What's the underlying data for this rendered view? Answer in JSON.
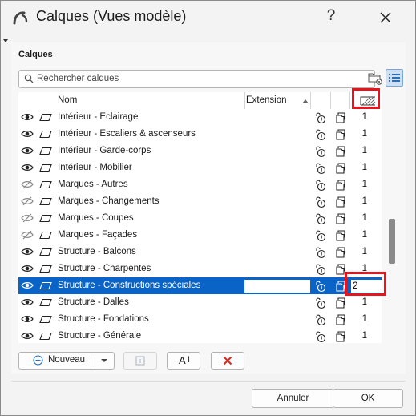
{
  "window": {
    "title": "Calques (Vues modèle)",
    "help_label": "?"
  },
  "panel": {
    "section_title": "Calques",
    "search": {
      "placeholder": "Rechercher calques",
      "value": ""
    }
  },
  "table": {
    "headers": {
      "name": "Nom",
      "extension": "Extension"
    },
    "rows": [
      {
        "name": "Intérieur - Eclairage",
        "visible": true,
        "order": "1"
      },
      {
        "name": "Intérieur - Escaliers & ascenseurs",
        "visible": true,
        "order": "1"
      },
      {
        "name": "Intérieur - Garde-corps",
        "visible": true,
        "order": "1"
      },
      {
        "name": "Intérieur - Mobilier",
        "visible": true,
        "order": "1"
      },
      {
        "name": "Marques - Autres",
        "visible": false,
        "order": "1"
      },
      {
        "name": "Marques - Changements",
        "visible": false,
        "order": "1"
      },
      {
        "name": "Marques - Coupes",
        "visible": false,
        "order": "1"
      },
      {
        "name": "Marques - Façades",
        "visible": false,
        "order": "1"
      },
      {
        "name": "Structure - Balcons",
        "visible": true,
        "order": "1"
      },
      {
        "name": "Structure - Charpentes",
        "visible": true,
        "order": "1"
      },
      {
        "name": "Structure - Constructions spéciales",
        "visible": true,
        "order": "2",
        "selected": true
      },
      {
        "name": "Structure - Dalles",
        "visible": true,
        "order": "1"
      },
      {
        "name": "Structure - Fondations",
        "visible": true,
        "order": "1"
      },
      {
        "name": "Structure - Générale",
        "visible": true,
        "order": "1"
      }
    ]
  },
  "toolbar": {
    "new_label": "Nouveau",
    "rename_label": "A"
  },
  "footer": {
    "cancel_label": "Annuler",
    "ok_label": "OK"
  },
  "colors": {
    "selection": "#0a64c8",
    "highlight": "#e8141c",
    "delete_icon": "#d9271c",
    "list_toggle": "#2a6fb8"
  },
  "icons": [
    "app-arc-icon",
    "close-icon",
    "search-icon",
    "folder-settings-icon",
    "list-view-icon",
    "eye-icon",
    "eye-hidden-icon",
    "parallelogram-icon",
    "lock-icon",
    "stack-icon",
    "hatch-order-icon",
    "plus-circle-icon",
    "chevron-down-icon",
    "add-layer-icon",
    "rename-icon",
    "delete-x-icon"
  ]
}
